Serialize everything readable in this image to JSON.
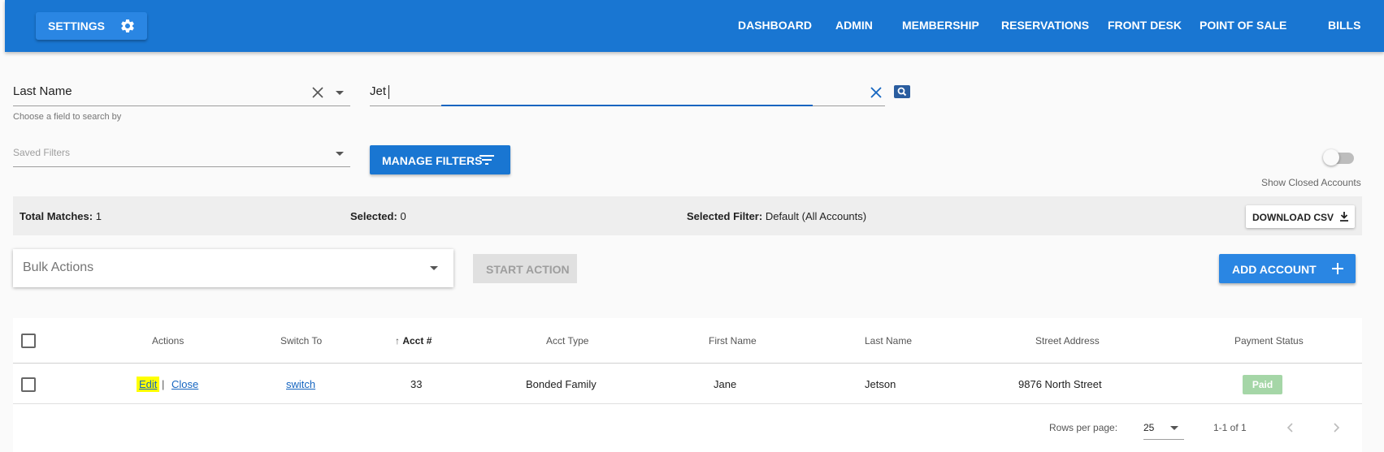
{
  "topbar": {
    "settings_label": "SETTINGS",
    "nav": [
      "DASHBOARD",
      "ADMIN",
      "MEMBERSHIP",
      "RESERVATIONS",
      "FRONT DESK",
      "POINT OF SALE",
      "BILLS"
    ]
  },
  "search": {
    "field_value": "Last Name",
    "field_hint": "Choose a field to search by",
    "query_value": "Jet"
  },
  "filters": {
    "saved_placeholder": "Saved Filters",
    "manage_label": "MANAGE FILTERS",
    "show_closed_label": "Show Closed Accounts",
    "show_closed_on": false
  },
  "summary": {
    "total_label": "Total Matches:",
    "total_value": "1",
    "selected_label": "Selected:",
    "selected_value": "0",
    "filter_label": "Selected Filter:",
    "filter_value": "Default (All Accounts)",
    "download_label": "DOWNLOAD CSV"
  },
  "actions": {
    "bulk_placeholder": "Bulk Actions",
    "start_label": "START ACTION",
    "add_label": "ADD ACCOUNT"
  },
  "table": {
    "headers": {
      "actions": "Actions",
      "switch": "Switch To",
      "acct": "Acct #",
      "type": "Acct Type",
      "first": "First Name",
      "last": "Last Name",
      "street": "Street Address",
      "payment": "Payment Status"
    },
    "rows": [
      {
        "edit": "Edit",
        "sep": "|",
        "close": "Close",
        "switch": "switch",
        "acct": "33",
        "type": "Bonded Family",
        "first": "Jane",
        "last": "Jetson",
        "street": "9876 North Street",
        "payment": "Paid"
      }
    ],
    "footer": {
      "rows_per_page_label": "Rows per page:",
      "rows_per_page_value": "25",
      "range": "1-1 of 1"
    }
  },
  "colors": {
    "primary": "#1976d2",
    "highlight": "#ffff00",
    "paid_badge": "#a5d6a7"
  }
}
